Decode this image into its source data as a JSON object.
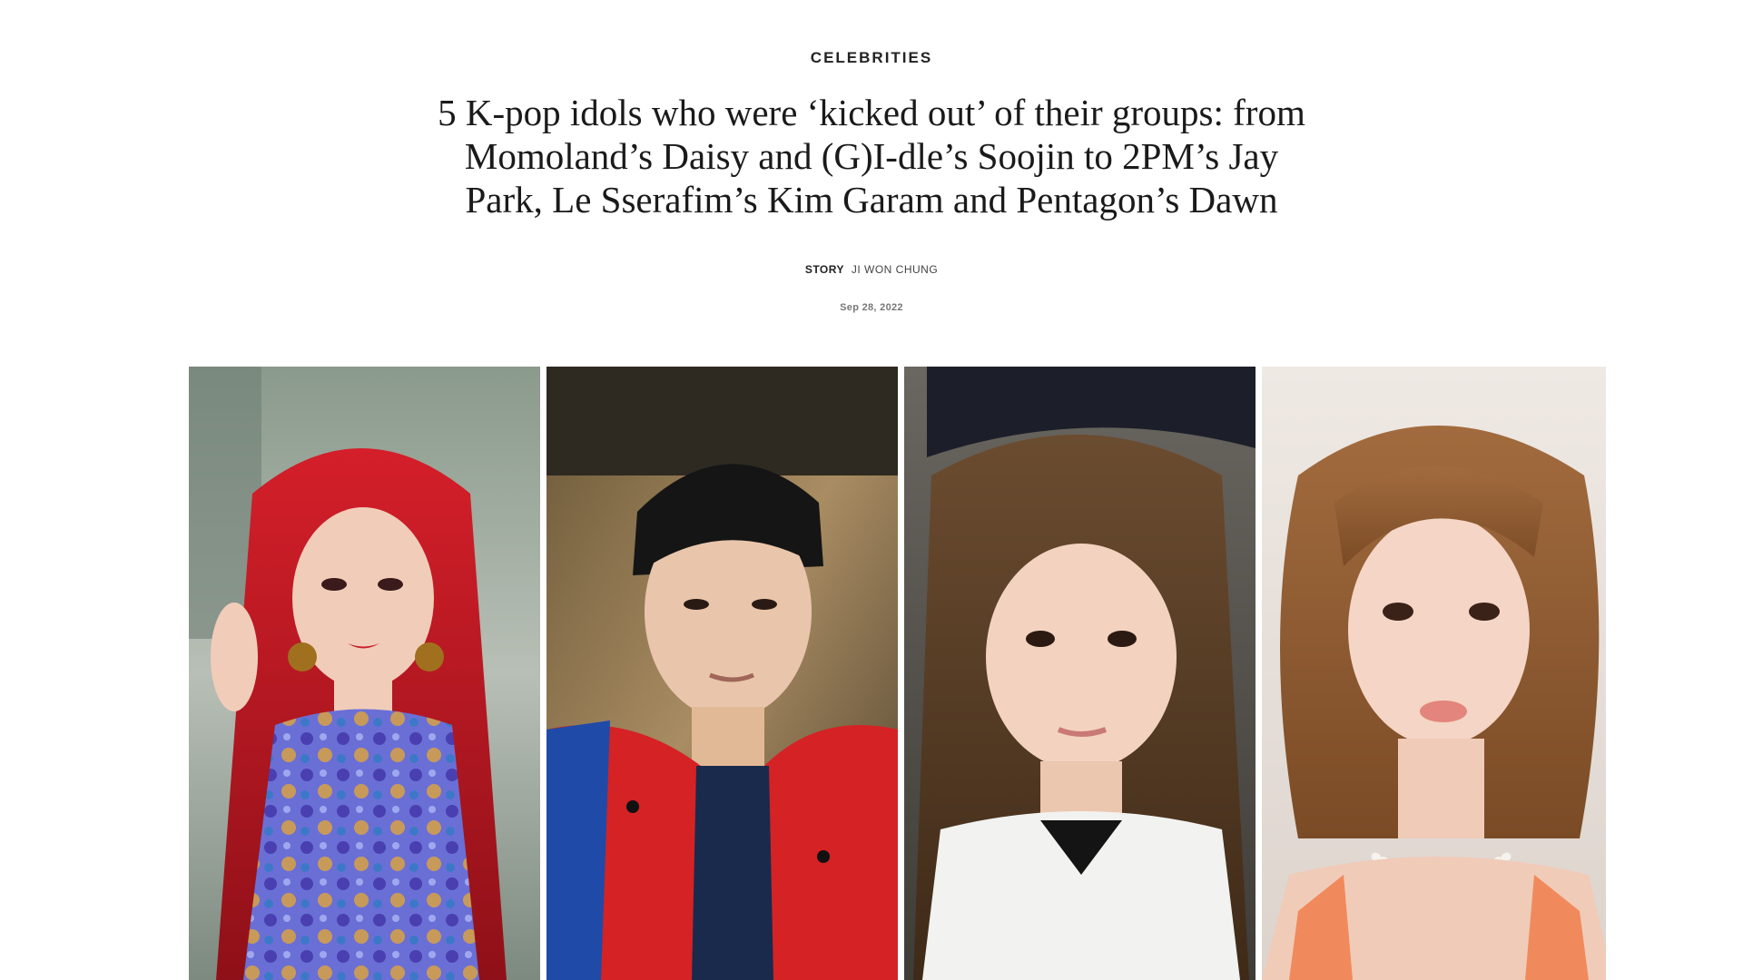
{
  "article": {
    "category": "CELEBRITIES",
    "headline": "5 K-pop idols who were ‘kicked out’ of their groups: from Momoland’s Daisy and (G)I-dle’s Soojin to 2PM’s Jay Park, Le Sserafim’s Kim Garam and Pentagon’s Dawn",
    "byline": {
      "label": "STORY",
      "author": "JI WON CHUNG"
    },
    "date": "Sep 28, 2022"
  },
  "hero": {
    "panels": [
      {
        "name": "photo-1"
      },
      {
        "name": "photo-2"
      },
      {
        "name": "photo-3"
      },
      {
        "name": "photo-4"
      }
    ]
  }
}
